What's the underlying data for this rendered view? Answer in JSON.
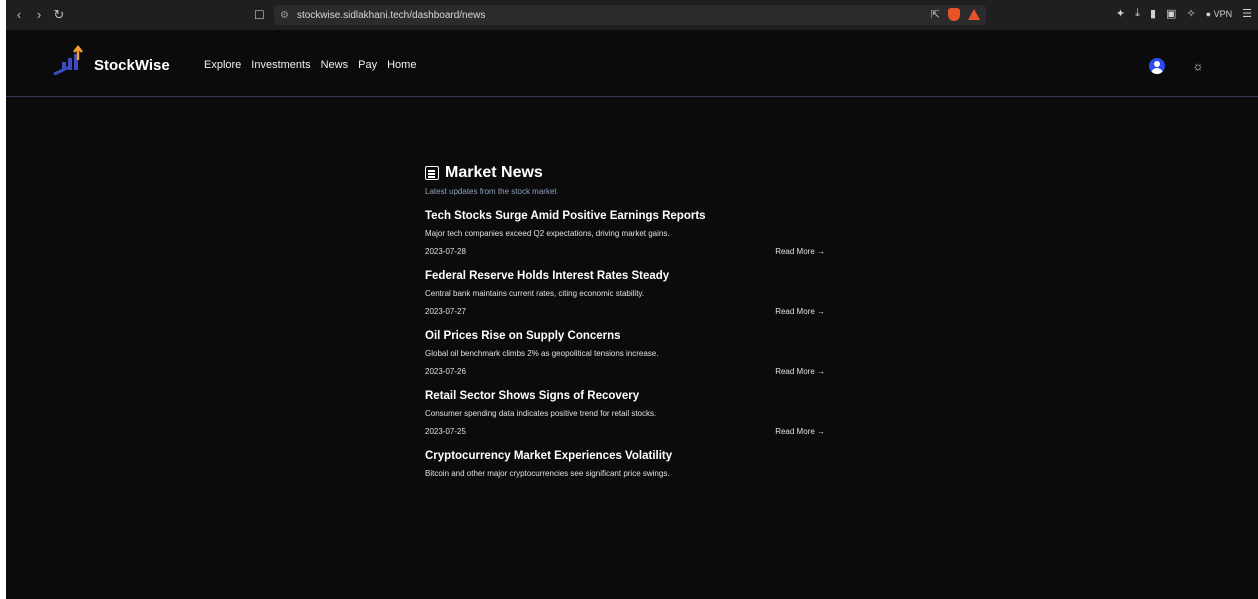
{
  "browser": {
    "url": "stockwise.sidlakhani.tech/dashboard/news",
    "vpn_label": "VPN"
  },
  "header": {
    "brand": "StockWise",
    "nav": [
      "Explore",
      "Investments",
      "News",
      "Pay",
      "Home"
    ]
  },
  "news": {
    "title": "Market News",
    "subtitle": "Latest updates from the stock market",
    "read_more_label": "Read More →",
    "articles": [
      {
        "title": "Tech Stocks Surge Amid Positive Earnings Reports",
        "description": "Major tech companies exceed Q2 expectations, driving market gains.",
        "date": "2023-07-28"
      },
      {
        "title": "Federal Reserve Holds Interest Rates Steady",
        "description": "Central bank maintains current rates, citing economic stability.",
        "date": "2023-07-27"
      },
      {
        "title": "Oil Prices Rise on Supply Concerns",
        "description": "Global oil benchmark climbs 2% as geopolitical tensions increase.",
        "date": "2023-07-26"
      },
      {
        "title": "Retail Sector Shows Signs of Recovery",
        "description": "Consumer spending data indicates positive trend for retail stocks.",
        "date": "2023-07-25"
      },
      {
        "title": "Cryptocurrency Market Experiences Volatility",
        "description": "Bitcoin and other major cryptocurrencies see significant price swings."
      }
    ]
  },
  "colors": {
    "background": "#0b0b0c",
    "header_border": "#34345a",
    "subtitle": "#8f9fbf",
    "avatar": "#2a4cf0",
    "logo_arrow": "#f0a030"
  }
}
